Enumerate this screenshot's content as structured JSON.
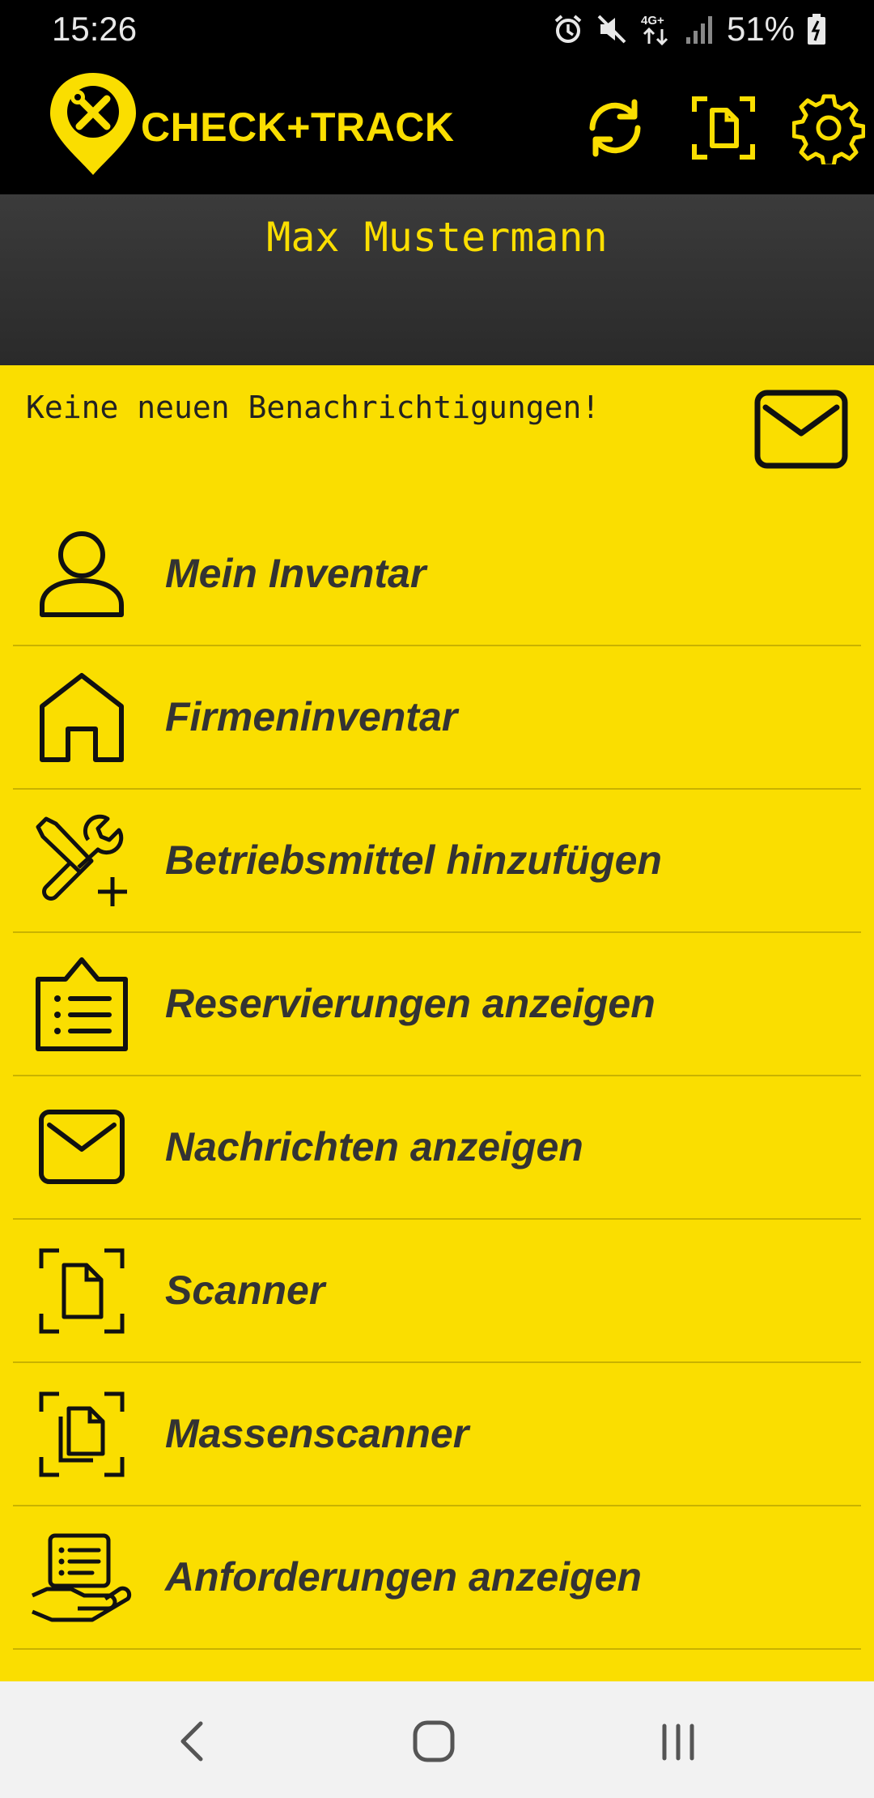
{
  "status_bar": {
    "time": "15:26",
    "battery_percent": "51%",
    "network": "4G+",
    "icons": [
      "alarm-icon",
      "mute-icon",
      "network-4g-icon",
      "signal-icon",
      "battery-icon"
    ]
  },
  "app_bar": {
    "title": "CHECK+TRACK",
    "actions": [
      "sync-icon",
      "scan-document-icon",
      "gear-icon"
    ]
  },
  "header": {
    "user_name": "Max Mustermann"
  },
  "notification": {
    "text": "Keine neuen Benachrichtigungen!",
    "icon": "mail-icon"
  },
  "menu": {
    "items": [
      {
        "label": "Mein Inventar",
        "icon": "person-icon"
      },
      {
        "label": "Firmeninventar",
        "icon": "house-icon"
      },
      {
        "label": "Betriebsmittel hinzufügen",
        "icon": "tools-add-icon"
      },
      {
        "label": "Reservierungen anzeigen",
        "icon": "clipboard-list-icon"
      },
      {
        "label": "Nachrichten anzeigen",
        "icon": "mail-icon"
      },
      {
        "label": "Scanner",
        "icon": "scan-document-icon"
      },
      {
        "label": "Massenscanner",
        "icon": "scan-multiple-documents-icon"
      },
      {
        "label": "Anforderungen anzeigen",
        "icon": "hand-document-icon"
      }
    ]
  },
  "nav_bar": {
    "buttons": [
      "back-icon",
      "home-icon",
      "recent-apps-icon"
    ]
  },
  "colors": {
    "accent_yellow": "#FADE00",
    "app_bar_black": "#000000",
    "header_dark": "#333333",
    "text_dark": "#333333"
  }
}
